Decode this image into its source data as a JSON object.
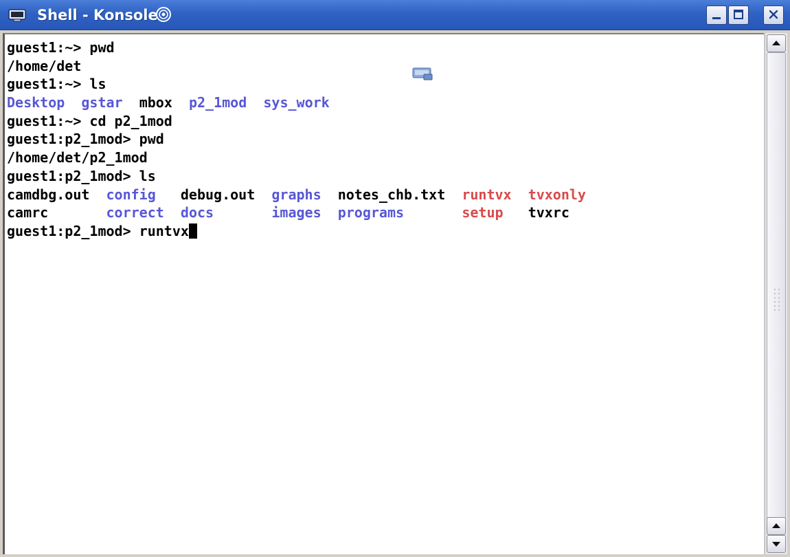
{
  "window": {
    "title": "Shell - Konsole"
  },
  "terminal": {
    "lines": [
      [
        {
          "text": "guest1:~> pwd",
          "color": "black"
        }
      ],
      [
        {
          "text": "/home/det",
          "color": "black"
        }
      ],
      [
        {
          "text": "guest1:~> ls",
          "color": "black"
        }
      ],
      [
        {
          "text": "Desktop",
          "color": "blue"
        },
        {
          "text": "  ",
          "color": "black"
        },
        {
          "text": "gstar",
          "color": "blue"
        },
        {
          "text": "  ",
          "color": "black"
        },
        {
          "text": "mbox",
          "color": "black"
        },
        {
          "text": "  ",
          "color": "black"
        },
        {
          "text": "p2_1mod",
          "color": "blue"
        },
        {
          "text": "  ",
          "color": "black"
        },
        {
          "text": "sys_work",
          "color": "blue"
        }
      ],
      [
        {
          "text": "guest1:~> cd p2_1mod",
          "color": "black"
        }
      ],
      [
        {
          "text": "guest1:p2_1mod> pwd",
          "color": "black"
        }
      ],
      [
        {
          "text": "/home/det/p2_1mod",
          "color": "black"
        }
      ],
      [
        {
          "text": "guest1:p2_1mod> ls",
          "color": "black"
        }
      ],
      [
        {
          "text": "camdbg.out",
          "color": "black"
        },
        {
          "text": "  ",
          "color": "black"
        },
        {
          "text": "config",
          "color": "blue"
        },
        {
          "text": "   ",
          "color": "black"
        },
        {
          "text": "debug.out",
          "color": "black"
        },
        {
          "text": "  ",
          "color": "black"
        },
        {
          "text": "graphs",
          "color": "blue"
        },
        {
          "text": "  ",
          "color": "black"
        },
        {
          "text": "notes_chb.txt",
          "color": "black"
        },
        {
          "text": "  ",
          "color": "black"
        },
        {
          "text": "runtvx",
          "color": "red"
        },
        {
          "text": "  ",
          "color": "black"
        },
        {
          "text": "tvxonly",
          "color": "red"
        }
      ],
      [
        {
          "text": "camrc",
          "color": "black"
        },
        {
          "text": "       ",
          "color": "black"
        },
        {
          "text": "correct",
          "color": "blue"
        },
        {
          "text": "  ",
          "color": "black"
        },
        {
          "text": "docs",
          "color": "blue"
        },
        {
          "text": "       ",
          "color": "black"
        },
        {
          "text": "images",
          "color": "blue"
        },
        {
          "text": "  ",
          "color": "black"
        },
        {
          "text": "programs",
          "color": "blue"
        },
        {
          "text": "       ",
          "color": "black"
        },
        {
          "text": "setup",
          "color": "red"
        },
        {
          "text": "   ",
          "color": "black"
        },
        {
          "text": "tvxrc",
          "color": "black"
        }
      ],
      [
        {
          "text": "guest1:p2_1mod> runtvx",
          "color": "black"
        }
      ]
    ]
  },
  "colors": {
    "titlebar": "#2f62c4",
    "directory": "#5757d6",
    "executable": "#d94a4a",
    "text": "#000000",
    "background": "#ffffff"
  },
  "icons": {
    "app": "konsole-monitor-icon",
    "title_decoration": "spiral-icon",
    "desktop_overlay": "computer-icon",
    "minimize": "minimize-icon",
    "maximize": "maximize-icon",
    "close": "close-icon",
    "scroll_up": "arrow-up-icon",
    "scroll_down": "arrow-down-icon"
  }
}
